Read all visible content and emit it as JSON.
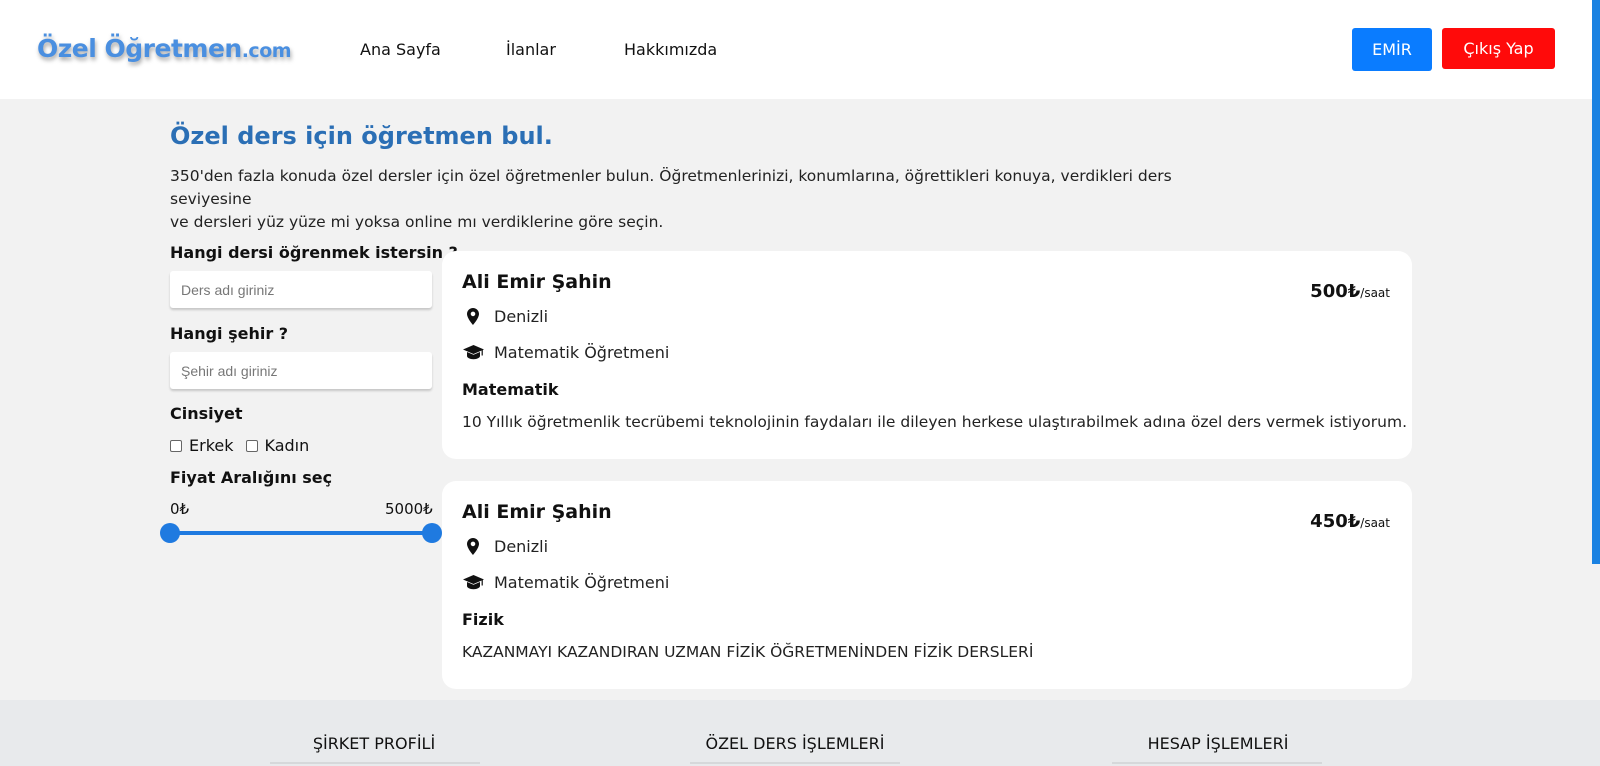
{
  "brand": {
    "name": "Özel Öğretmen",
    "tld": ".com"
  },
  "nav": {
    "home": "Ana Sayfa",
    "listings": "İlanlar",
    "about": "Hakkımızda"
  },
  "user": {
    "name": "EMİR",
    "logout": "Çıkış Yap"
  },
  "hero": {
    "title": "Özel ders için öğretmen bul.",
    "line1": "350'den fazla konuda özel dersler için özel öğretmenler bulun. Öğretmenlerinizi, konumlarına, öğrettikleri konuya, verdikleri ders seviyesine",
    "line2": "ve dersleri yüz yüze mi yoksa online mı verdiklerine göre seçin."
  },
  "filters": {
    "subject_label": "Hangi dersi öğrenmek istersin ?",
    "subject_placeholder": "Ders adı giriniz",
    "city_label": "Hangi şehir ?",
    "city_placeholder": "Şehir adı giriniz",
    "gender_label": "Cinsiyet",
    "male": "Erkek",
    "female": "Kadın",
    "price_label": "Fiyat Aralığını seç",
    "price_min": "0₺",
    "price_max": "5000₺",
    "range_low_fraction": 0,
    "range_high_fraction": 1
  },
  "listings": [
    {
      "name": "Ali Emir Şahin",
      "price": "500₺",
      "unit": "/saat",
      "city": "Denizli",
      "role": "Matematik Öğretmeni",
      "subject": "Matematik",
      "description": "10 Yıllık öğretmenlik tecrübemi teknolojinin faydaları ile dileyen herkese ulaştırabilmek adına özel ders vermek istiyorum."
    },
    {
      "name": "Ali Emir Şahin",
      "price": "450₺",
      "unit": "/saat",
      "city": "Denizli",
      "role": "Matematik Öğretmeni",
      "subject": "Fizik",
      "description": "KAZANMAYI KAZANDIRAN UZMAN FİZİK ÖĞRETMENİNDEN FİZİK DERSLERİ"
    }
  ],
  "footer": {
    "company": "ŞİRKET PROFİLİ",
    "lessons": "ÖZEL DERS İŞLEMLERİ",
    "account": "HESAP İŞLEMLERİ"
  },
  "colors": {
    "primary": "#0a7cff",
    "danger": "#ff0a0a",
    "title": "#2b6fb5",
    "logo": "#4a8fe0",
    "slider": "#1f7ae0"
  },
  "icons": {
    "location": "map-pin-icon",
    "role": "graduation-cap-icon"
  }
}
